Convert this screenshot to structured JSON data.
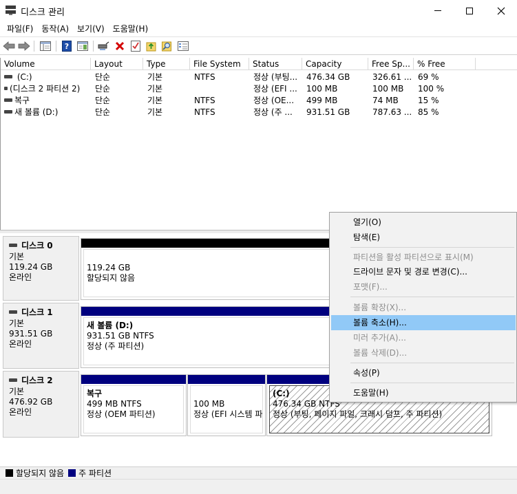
{
  "window": {
    "title": "디스크 관리",
    "icon": "disk-management-icon"
  },
  "menu": [
    "파일(F)",
    "동작(A)",
    "보기(V)",
    "도움말(H)"
  ],
  "toolbar": {
    "buttons": [
      "back-icon",
      "forward-icon",
      "console-tree-icon",
      "help-icon",
      "show-pane-icon",
      "connect-drive-icon",
      "delete-icon",
      "checklist-icon",
      "import-icon",
      "search-icon",
      "properties-icon"
    ],
    "colors": {
      "delete": "#d40000",
      "help": "#1e4da8"
    }
  },
  "volume_list": {
    "columns": [
      "Volume",
      "Layout",
      "Type",
      "File System",
      "Status",
      "Capacity",
      "Free Sp...",
      "% Free"
    ],
    "rows": [
      {
        "volume": " (C:)",
        "layout": "단순",
        "type": "기본",
        "fs": "NTFS",
        "status": "정상 (부팅...",
        "capacity": "476.34 GB",
        "free": "326.61 ...",
        "pct": "69 %"
      },
      {
        "volume": "(디스크 2 파티션 2)",
        "layout": "단순",
        "type": "기본",
        "fs": "",
        "status": "정상 (EFI ...",
        "capacity": "100 MB",
        "free": "100 MB",
        "pct": "100 %"
      },
      {
        "volume": "복구",
        "layout": "단순",
        "type": "기본",
        "fs": "NTFS",
        "status": "정상 (OE...",
        "capacity": "499 MB",
        "free": "74 MB",
        "pct": "15 %"
      },
      {
        "volume": "새 볼륨 (D:)",
        "layout": "단순",
        "type": "기본",
        "fs": "NTFS",
        "status": "정상 (주 ...",
        "capacity": "931.51 GB",
        "free": "787.63 ...",
        "pct": "85 %"
      }
    ]
  },
  "disks": [
    {
      "name": "디스크 0",
      "kind": "기본",
      "size": "119.24 GB",
      "state": "온라인",
      "partitions": [
        {
          "name": "",
          "line1": "119.24 GB",
          "line2": "할당되지 않음"
        }
      ]
    },
    {
      "name": "디스크 1",
      "kind": "기본",
      "size": "931.51 GB",
      "state": "온라인",
      "partitions": [
        {
          "name": "새 볼륨  (D:)",
          "line1": "931.51 GB NTFS",
          "line2": "정상 (주 파티션)"
        }
      ]
    },
    {
      "name": "디스크 2",
      "kind": "기본",
      "size": "476.92 GB",
      "state": "온라인",
      "partitions": [
        {
          "name": "복구",
          "line1": "499 MB NTFS",
          "line2": "정상 (OEM 파티션)"
        },
        {
          "name": "",
          "line1": "100 MB",
          "line2": "정상 (EFI 시스템 파"
        },
        {
          "name": " (C:)",
          "line1": "476.34 GB NTFS",
          "line2": "정상 (부팅, 페이지 파일, 크래시 덤프, 주 파티션)"
        }
      ]
    }
  ],
  "legend": {
    "items": [
      {
        "label": "할당되지 않음",
        "color": "#000000"
      },
      {
        "label": "주 파티션",
        "color": "#00007f"
      }
    ]
  },
  "context_menu": {
    "items": [
      {
        "label": "열기(O)",
        "disabled": false
      },
      {
        "label": "탐색(E)",
        "disabled": false
      },
      {
        "label": "파티션을 활성 파티션으로 표시(M)",
        "disabled": true
      },
      {
        "label": "드라이브 문자 및 경로 변경(C)...",
        "disabled": false
      },
      {
        "label": "포맷(F)...",
        "disabled": true
      },
      {
        "label": "볼륨 확장(X)...",
        "disabled": true
      },
      {
        "label": "볼륨 축소(H)...",
        "disabled": false,
        "highlighted": true
      },
      {
        "label": "미러 추가(A)...",
        "disabled": true
      },
      {
        "label": "볼륨 삭제(D)...",
        "disabled": true
      },
      {
        "label": "속성(P)",
        "disabled": false
      },
      {
        "label": "도움말(H)",
        "disabled": false
      }
    ],
    "highlight_color": "#91c9f7"
  }
}
